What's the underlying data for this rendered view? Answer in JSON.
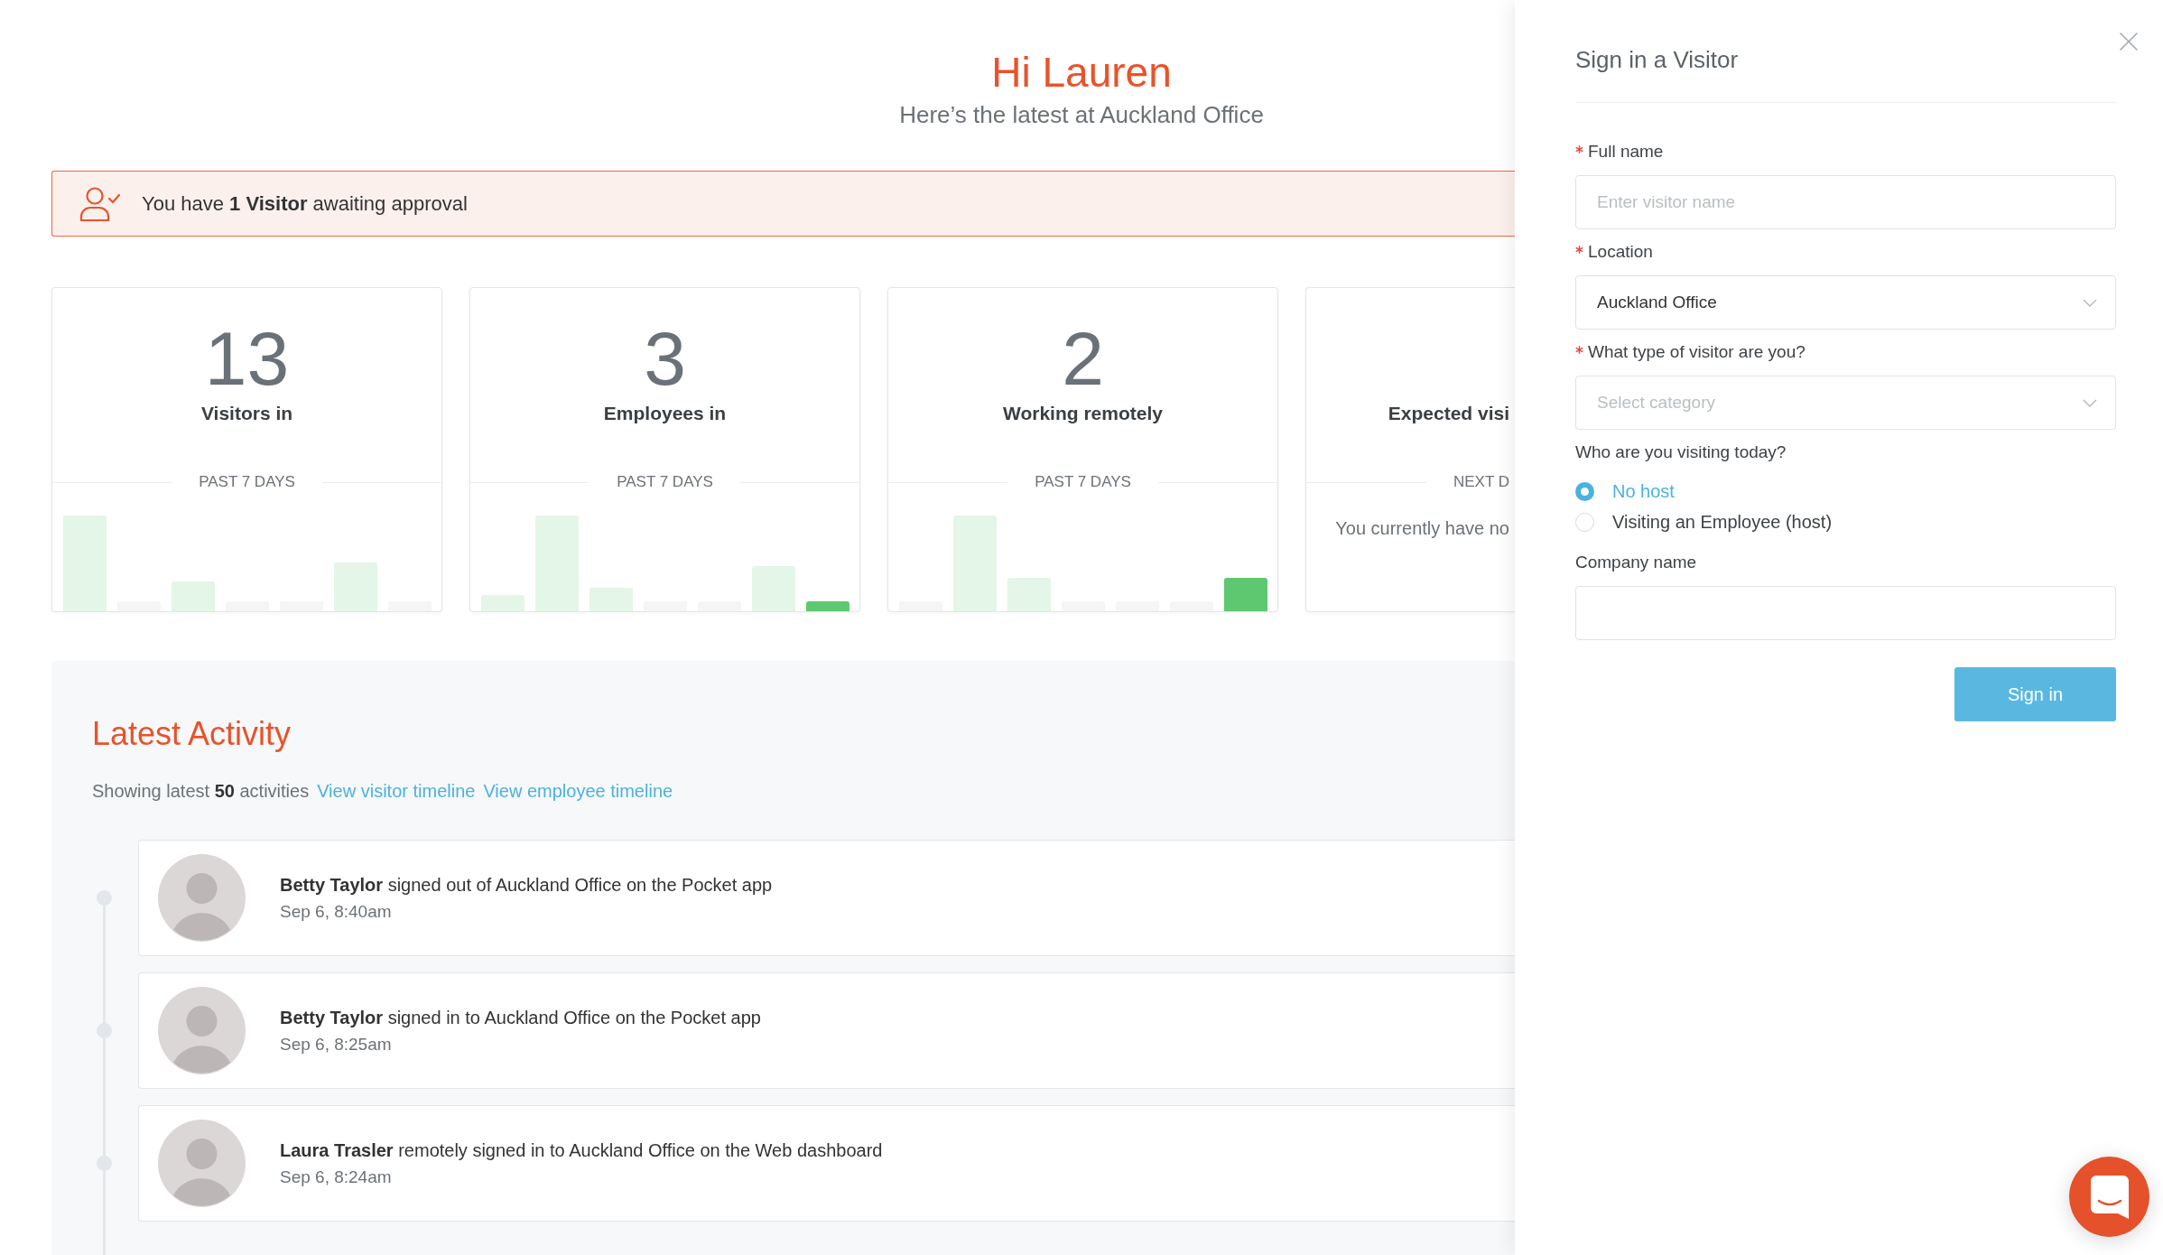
{
  "greeting": {
    "title": "Hi Lauren",
    "subtitle": "Here’s the latest at Auckland Office"
  },
  "alert": {
    "text": "You have **1 Visitor** awaiting approval"
  },
  "stats": [
    {
      "kind": "chart",
      "value": "13",
      "label": "Visitors in",
      "period": "PAST 7 DAYS"
    },
    {
      "kind": "chart",
      "value": "3",
      "label": "Employees in",
      "period": "PAST 7 DAYS"
    },
    {
      "kind": "chart",
      "value": "2",
      "label": "Working remotely",
      "period": "PAST 7 DAYS"
    },
    {
      "kind": "message",
      "label": "Expected visi",
      "period": "NEXT D",
      "message": "You currently have no"
    }
  ],
  "activity": {
    "title": "Latest Activity",
    "summary": "Showing latest **50** activities",
    "links": [
      "View visitor timeline",
      "View employee timeline"
    ],
    "items": [
      {
        "text": "**Betty Taylor** signed out of Auckland Office on the Pocket app",
        "time": "Sep 6, 8:40am"
      },
      {
        "text": "**Betty Taylor** signed in to Auckland Office on the Pocket app",
        "time": "Sep 6, 8:25am"
      },
      {
        "text": "**Laura Trasler** remotely signed in to Auckland Office on the Web dashboard",
        "time": "Sep 6, 8:24am"
      }
    ]
  },
  "drawer": {
    "title": "Sign in a Visitor",
    "fields": [
      {
        "kind": "text",
        "label": "Full name",
        "required": true,
        "placeholder": "Enter visitor name"
      },
      {
        "kind": "select",
        "label": "Location",
        "required": true,
        "value": "Auckland Office"
      },
      {
        "kind": "select",
        "label": "What type of visitor are you?",
        "required": true,
        "placeholder": "Select category"
      },
      {
        "kind": "radio",
        "label": "Who are you visiting today?",
        "required": false,
        "options": [
          {
            "label": "No host",
            "selected": true
          },
          {
            "label": "Visiting an Employee (host)",
            "selected": false
          }
        ]
      },
      {
        "kind": "text",
        "label": "Company name",
        "required": false
      }
    ],
    "submit": "Sign in"
  }
}
